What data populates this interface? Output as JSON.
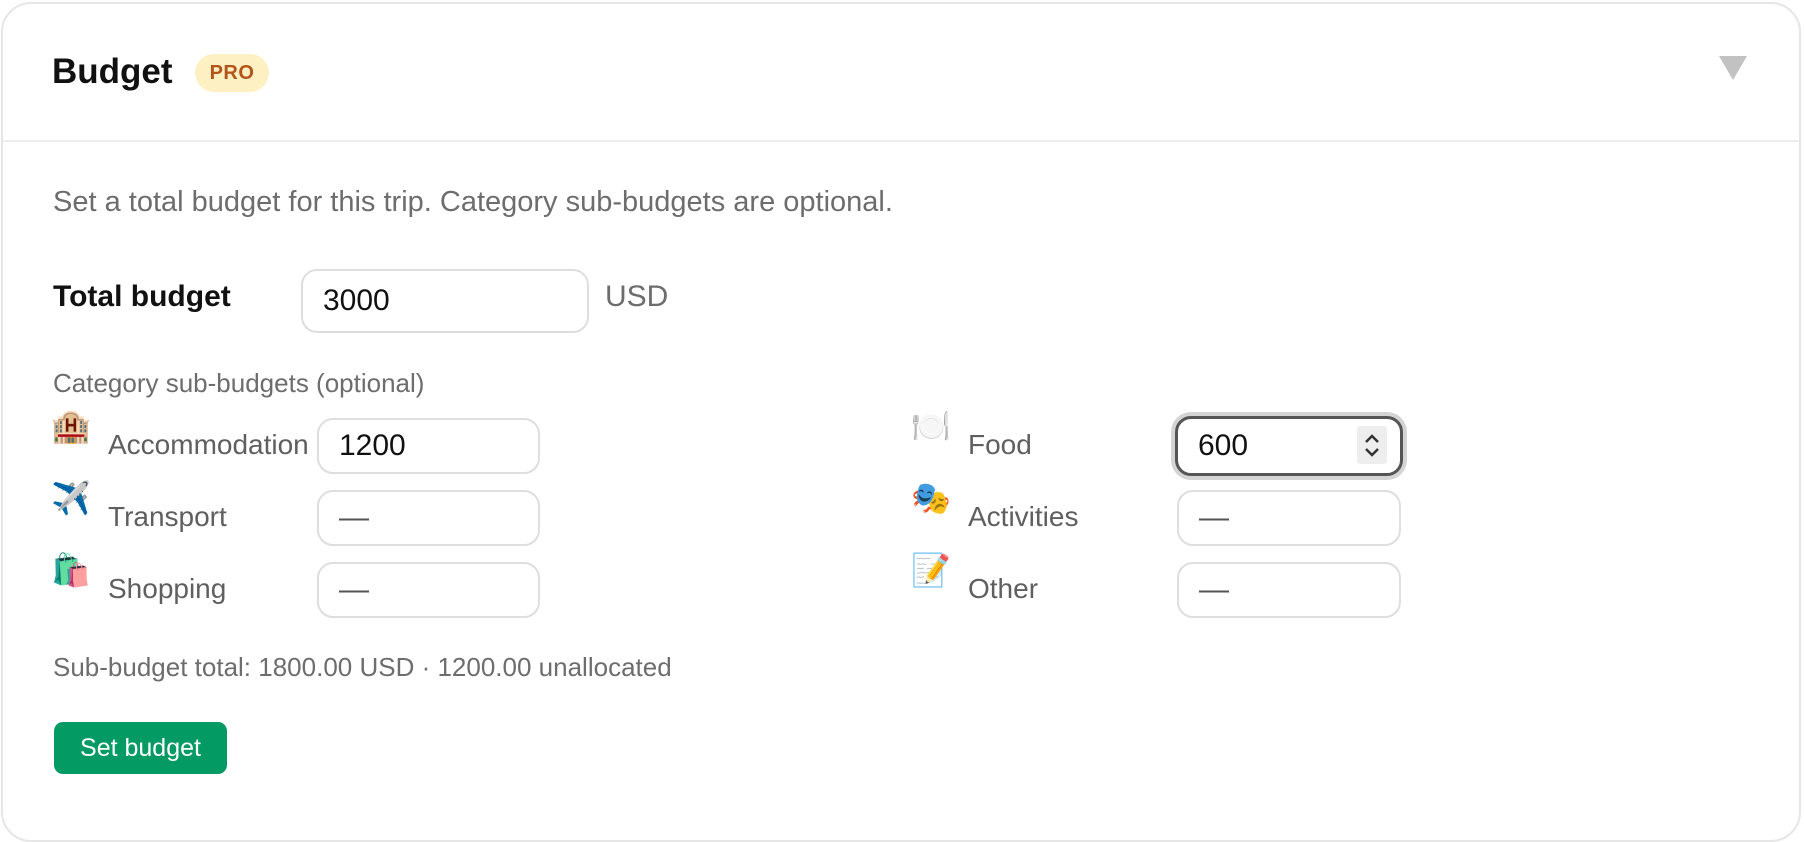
{
  "header": {
    "title": "Budget",
    "badge": "PRO"
  },
  "description": "Set a total budget for this trip. Category sub-budgets are optional.",
  "total": {
    "label": "Total budget",
    "value": "3000",
    "currency": "USD"
  },
  "categories_label": "Category sub-budgets (optional)",
  "categories": [
    {
      "icon": "hotel-icon",
      "emoji": "🏨",
      "label": "Accommodation",
      "value": "1200",
      "placeholder": "—"
    },
    {
      "icon": "fork-knife-plate-icon",
      "emoji": "🍽️",
      "label": "Food",
      "value": "600",
      "placeholder": "—"
    },
    {
      "icon": "airplane-icon",
      "emoji": "✈️",
      "label": "Transport",
      "value": "",
      "placeholder": "—"
    },
    {
      "icon": "theater-masks-icon",
      "emoji": "🎭",
      "label": "Activities",
      "value": "",
      "placeholder": "—"
    },
    {
      "icon": "shopping-bags-icon",
      "emoji": "🛍️",
      "label": "Shopping",
      "value": "",
      "placeholder": "—"
    },
    {
      "icon": "memo-pencil-icon",
      "emoji": "📝",
      "label": "Other",
      "value": "",
      "placeholder": "—"
    }
  ],
  "summary": "Sub-budget total: 1800.00 USD · 1200.00 unallocated",
  "button_label": "Set budget",
  "colors": {
    "accent": "#049a63",
    "badge_bg": "#fdf0c2",
    "badge_text": "#b4541a",
    "muted_text": "#6d6d6d"
  }
}
